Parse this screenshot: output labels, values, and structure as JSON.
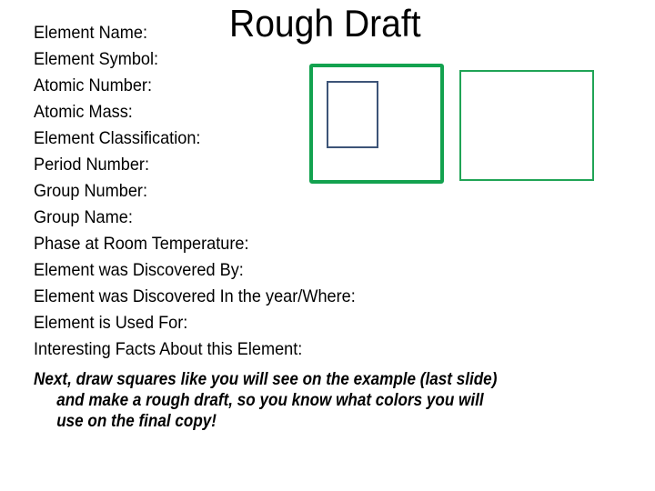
{
  "title": "Rough Draft",
  "fields": [
    "Element Name:",
    "Element Symbol:",
    "Atomic Number:",
    "Atomic Mass:",
    "Element Classification:",
    "Period Number:",
    "Group Number:",
    "Group Name:",
    "Phase at Room Temperature:",
    "Element was Discovered By:",
    "Element was Discovered In the year/Where:",
    "Element is Used For:",
    "Interesting Facts About this Element:"
  ],
  "instructions": {
    "lines": [
      "Next, draw squares like you will see on the example (last slide)",
      "and make a rough draft, so you know what colors you will",
      "use on the final copy!"
    ]
  },
  "colors": {
    "outer_box": "#13a24f",
    "inner_box": "#3d5478",
    "right_box": "#20a456"
  }
}
